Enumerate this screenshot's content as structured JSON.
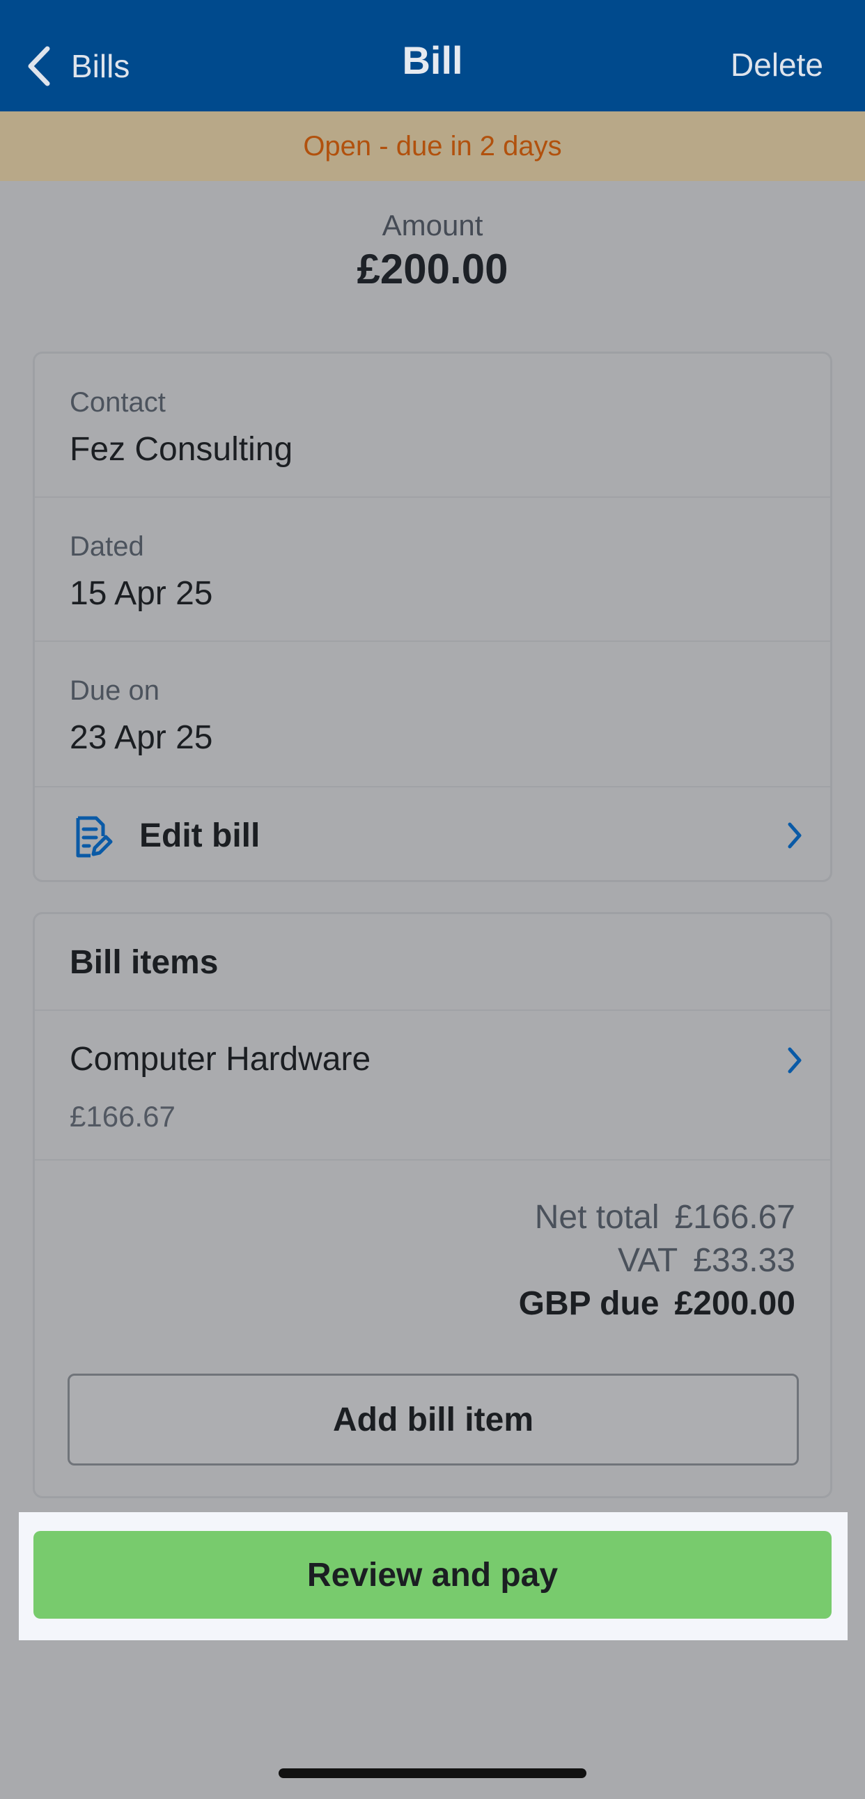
{
  "nav": {
    "back_label": "Bills",
    "title": "Bill",
    "delete_label": "Delete"
  },
  "status": {
    "text": "Open - due in 2 days"
  },
  "amount": {
    "label": "Amount",
    "value": "£200.00"
  },
  "details": {
    "contact_label": "Contact",
    "contact_value": "Fez Consulting",
    "dated_label": "Dated",
    "dated_value": "15 Apr 25",
    "due_label": "Due on",
    "due_value": "23 Apr 25",
    "edit_label": "Edit bill"
  },
  "bill_items": {
    "title": "Bill items",
    "items": [
      {
        "name": "Computer Hardware",
        "price": "£166.67"
      }
    ],
    "totals": {
      "net_label": "Net total",
      "net_value": "£166.67",
      "vat_label": "VAT",
      "vat_value": "£33.33",
      "due_label": "GBP due",
      "due_value": "£200.00"
    },
    "add_label": "Add bill item"
  },
  "actions": {
    "pay_label": "Review and pay"
  },
  "colors": {
    "navbar": "#004a8d",
    "status_text": "#b1510d",
    "accent": "#0a5aa6",
    "pay_button": "#78cb6d"
  }
}
